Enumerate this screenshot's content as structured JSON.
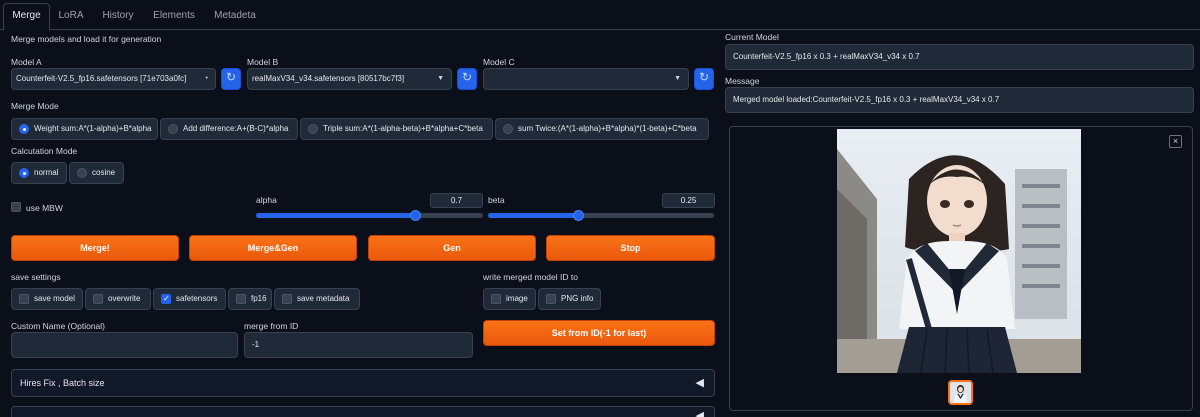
{
  "tabs": [
    "Merge",
    "LoRA",
    "History",
    "Elements",
    "Metadeta"
  ],
  "heading": "Merge models and load it for generation",
  "model_a": {
    "label": "Model A",
    "value": "Counterfeit-V2.5_fp16.safetensors [71e703a0fc]"
  },
  "model_b": {
    "label": "Model B",
    "value": "realMaxV34_v34.safetensors [80517bc7f3]"
  },
  "model_c": {
    "label": "Model C",
    "value": ""
  },
  "merge_mode": {
    "label": "Merge Mode",
    "options": [
      "Weight sum:A*(1-alpha)+B*alpha",
      "Add difference:A+(B-C)*alpha",
      "Triple sum:A*(1-alpha-beta)+B*alpha+C*beta",
      "sum Twice:(A*(1-alpha)+B*alpha)*(1-beta)+C*beta"
    ],
    "selected": "Weight sum:A*(1-alpha)+B*alpha"
  },
  "calc_mode": {
    "label": "Calcutation Mode",
    "options": [
      "normal",
      "cosine"
    ],
    "selected": "normal"
  },
  "use_mbw": {
    "label": "use MBW",
    "checked": false
  },
  "alpha": {
    "label": "alpha",
    "value": "0.7",
    "fraction": 0.7
  },
  "beta": {
    "label": "beta",
    "value": "0.25",
    "fraction": 0.4
  },
  "buttons": {
    "merge": "Merge!",
    "merge_gen": "Merge&Gen",
    "gen": "Gen",
    "stop": "Stop",
    "set_from_id": "Set from ID(-1 for last)"
  },
  "save_settings": {
    "label": "save settings",
    "options": [
      {
        "label": "save model",
        "checked": false
      },
      {
        "label": "overwrite",
        "checked": false
      },
      {
        "label": "safetensors",
        "checked": true
      },
      {
        "label": "fp16",
        "checked": false
      },
      {
        "label": "save metadata",
        "checked": false
      }
    ]
  },
  "write_id": {
    "label": "write merged model ID to",
    "options": [
      {
        "label": "image",
        "checked": false
      },
      {
        "label": "PNG info",
        "checked": false
      }
    ]
  },
  "custom_name": {
    "label": "Custom Name (Optional)",
    "value": ""
  },
  "merge_from_id": {
    "label": "merge from ID",
    "value": "-1"
  },
  "accordions": {
    "hires": "Hires Fix , Batch size"
  },
  "current_model": {
    "label": "Current Model",
    "value": "Counterfeit-V2.5_fp16 x 0.3 + realMaxV34_v34 x 0.7"
  },
  "message": {
    "label": "Message",
    "value": "Merged model loaded:Counterfeit-V2.5_fp16 x 0.3 + realMaxV34_v34 x 0.7"
  },
  "icons": {
    "refresh": "refresh-icon",
    "close": "close-icon",
    "collapse": "triangle-left-icon"
  },
  "colors": {
    "accent": "#f97316",
    "blue": "#2563eb",
    "bg": "#0b0f19"
  }
}
